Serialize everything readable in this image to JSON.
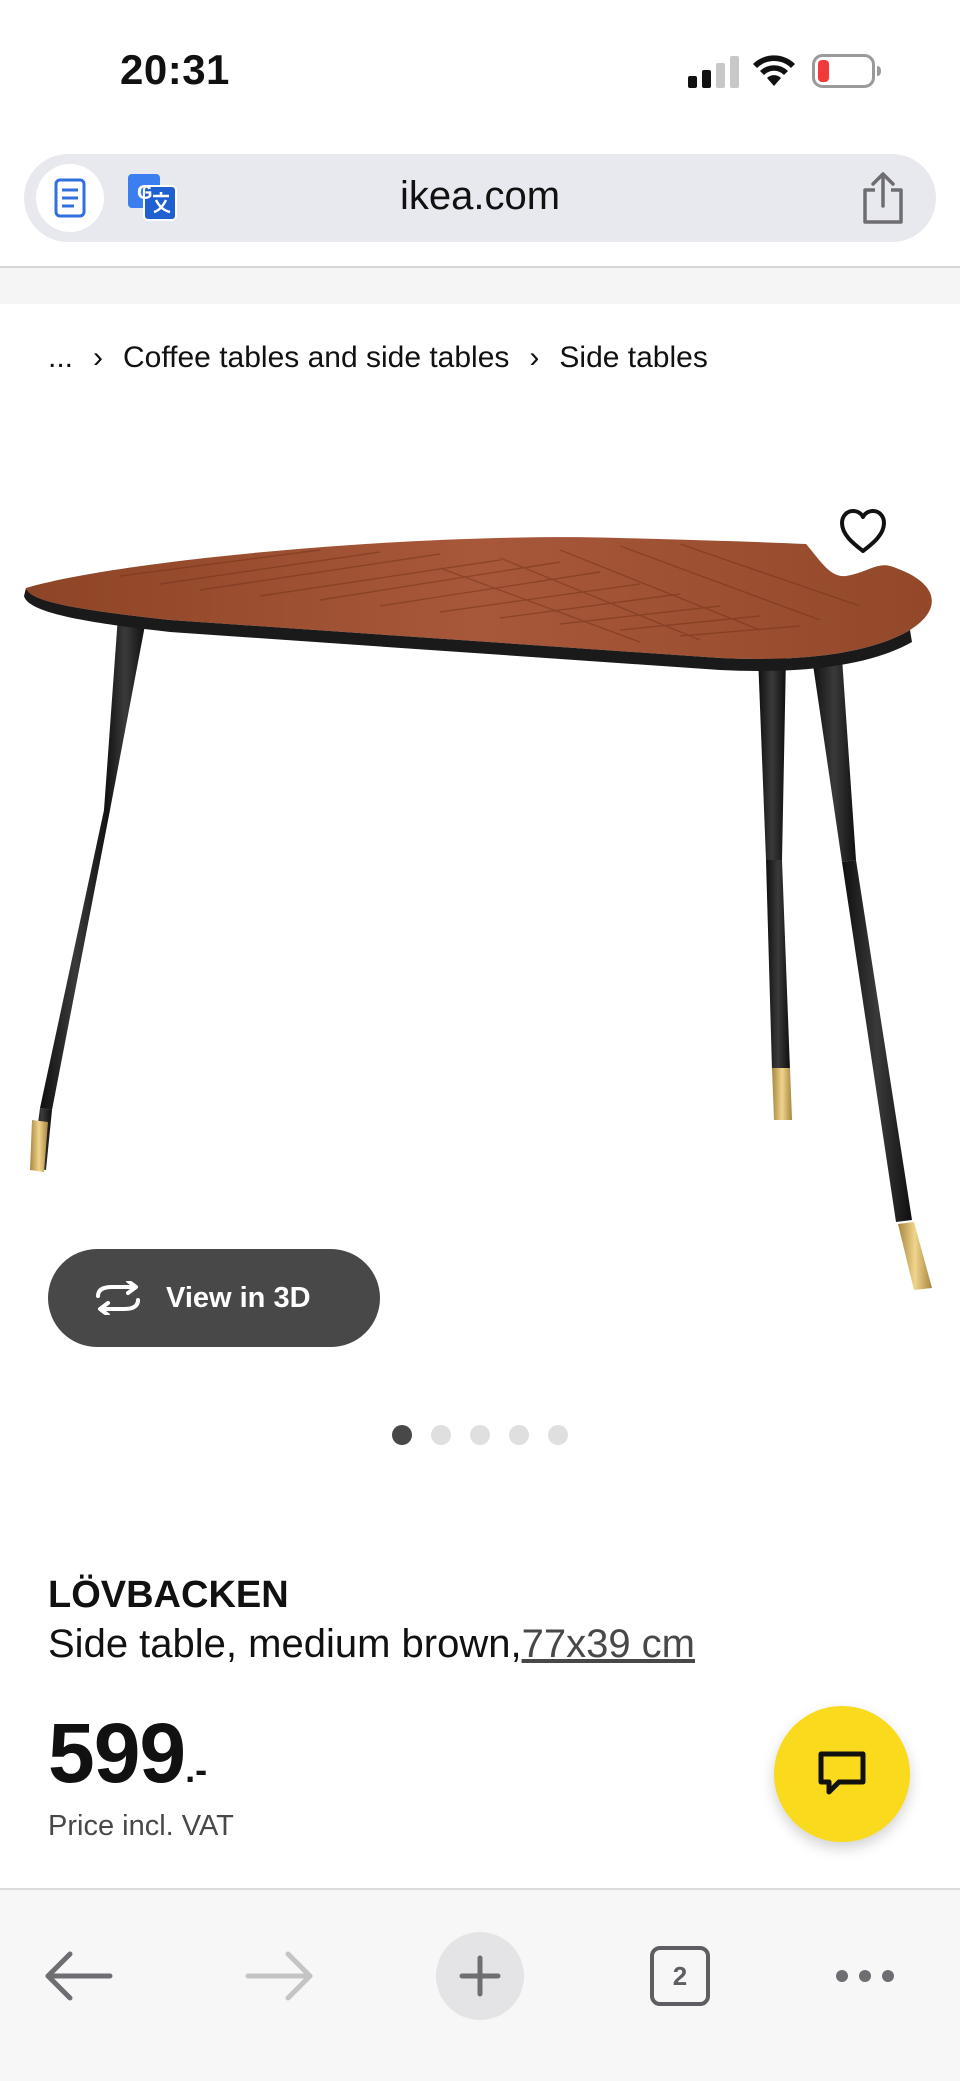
{
  "status_bar": {
    "time": "20:31"
  },
  "browser": {
    "url": "ikea.com",
    "tab_count": "2"
  },
  "breadcrumb": {
    "ellipsis": "...",
    "items": [
      "Coffee tables and side tables",
      "Side tables"
    ]
  },
  "gallery": {
    "view_3d_label": "View in 3D",
    "dot_count": 5,
    "active_dot": 0
  },
  "product": {
    "name": "LÖVBACKEN",
    "description": "Side table, medium brown,",
    "dimensions": "77x39 cm",
    "price_integer": "599",
    "price_suffix": ".-",
    "price_note": "Price incl. VAT"
  },
  "colors": {
    "ikea_yellow": "#fada1c",
    "dark_button": "#484848",
    "table_top": "#9a4e2c",
    "legs": "#1e1e1e",
    "brass_caps": "#c9a65a"
  }
}
